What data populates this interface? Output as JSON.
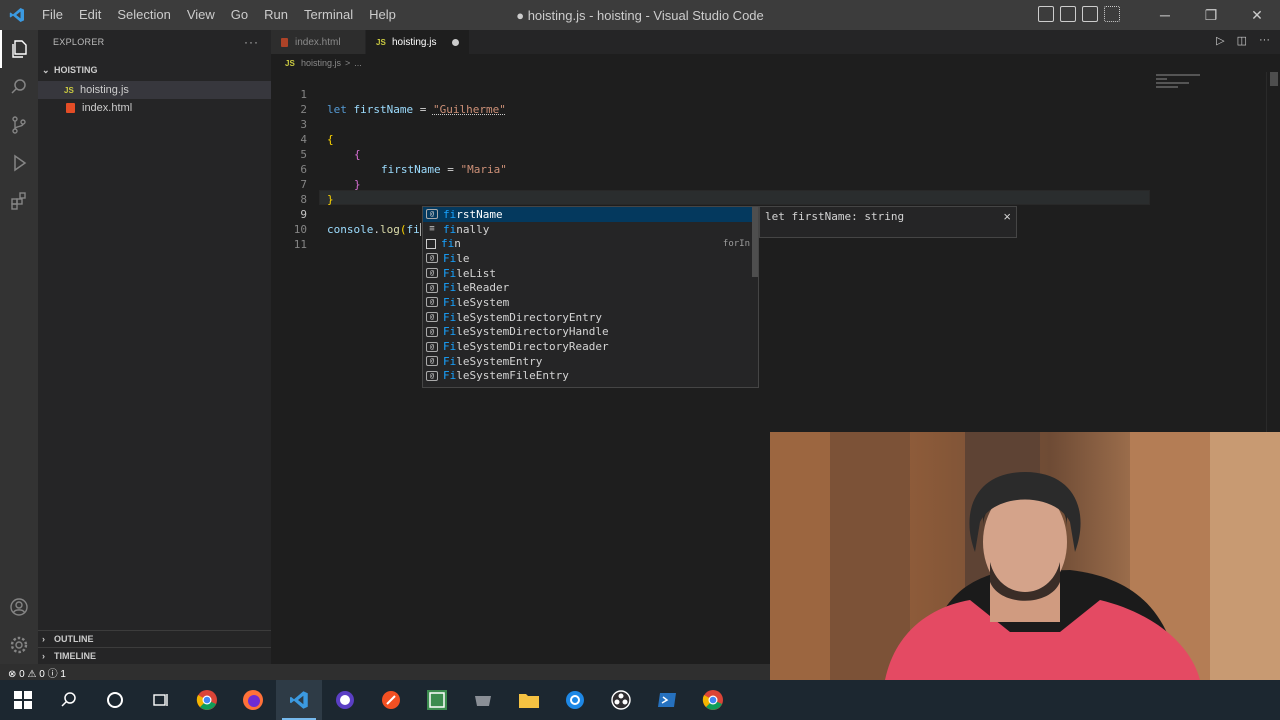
{
  "window": {
    "title": "● hoisting.js - hoisting - Visual Studio Code",
    "logo": "vscode-icon"
  },
  "menu": [
    "File",
    "Edit",
    "Selection",
    "View",
    "Go",
    "Run",
    "Terminal",
    "Help"
  ],
  "sidebar": {
    "header": "EXPLORER",
    "more": "···",
    "folder": "HOISTING",
    "files": [
      {
        "name": "hoisting.js",
        "type": "js",
        "icon_label": "JS",
        "active": true
      },
      {
        "name": "index.html",
        "type": "html",
        "active": false
      }
    ],
    "outline": "OUTLINE",
    "timeline": "TIMELINE"
  },
  "tabs": [
    {
      "label": "index.html",
      "active": false
    },
    {
      "label": "hoisting.js",
      "icon_label": "JS",
      "active": true,
      "dirty": true
    }
  ],
  "breadcrumb": {
    "icon_label": "JS",
    "file": "hoisting.js",
    "sep": ">",
    "rest": "..."
  },
  "editor": {
    "line_numbers": [
      "1",
      "2",
      "3",
      "4",
      "5",
      "6",
      "7",
      "8",
      "9",
      "10",
      "11"
    ],
    "current_line": 9,
    "lines": {
      "l1": {
        "kw": "let",
        "var": "firstName",
        "op": "=",
        "str": "\"Guilherme\""
      },
      "l3": {
        "brace": "{"
      },
      "l4": {
        "brace": "{"
      },
      "l5": {
        "var": "firstName",
        "op": "=",
        "str": "\"Maria\""
      },
      "l6": {
        "brace": "}"
      },
      "l7": {
        "brace": "}"
      },
      "l9": {
        "obj": "console",
        "dot": ".",
        "fn": "log",
        "paren": "(",
        "typed": "fi",
        "close": ")"
      }
    }
  },
  "suggest": {
    "items": [
      {
        "pre": "fi",
        "rest": "rstName",
        "kind": "variable",
        "icon": "[@]",
        "selected": true
      },
      {
        "pre": "fi",
        "rest": "nally",
        "kind": "keyword",
        "icon": "≡"
      },
      {
        "pre": "fi",
        "rest": "n",
        "kind": "snippet",
        "icon": "□",
        "detail": "forIn"
      },
      {
        "pre": "Fi",
        "rest": "le",
        "kind": "variable",
        "icon": "[@]"
      },
      {
        "pre": "Fi",
        "rest": "leList",
        "kind": "variable",
        "icon": "[@]"
      },
      {
        "pre": "Fi",
        "rest": "leReader",
        "kind": "variable",
        "icon": "[@]"
      },
      {
        "pre": "Fi",
        "rest": "leSystem",
        "kind": "variable",
        "icon": "[@]"
      },
      {
        "pre": "Fi",
        "rest": "leSystemDirectoryEntry",
        "kind": "variable",
        "icon": "[@]"
      },
      {
        "pre": "Fi",
        "rest": "leSystemDirectoryHandle",
        "kind": "variable",
        "icon": "[@]"
      },
      {
        "pre": "Fi",
        "rest": "leSystemDirectoryReader",
        "kind": "variable",
        "icon": "[@]"
      },
      {
        "pre": "Fi",
        "rest": "leSystemEntry",
        "kind": "variable",
        "icon": "[@]"
      },
      {
        "pre": "Fi",
        "rest": "leSystemFileEntry",
        "kind": "variable",
        "icon": "[@]"
      }
    ],
    "details": "let firstName: string",
    "close": "×"
  },
  "statusbar": {
    "remote_icon": "⊗",
    "errors": "0",
    "warn_icon": "⚠",
    "warnings": "0",
    "info_icon": "ⓘ",
    "info": "1"
  },
  "taskbar": {
    "icons": [
      "windows-start-icon",
      "search-icon",
      "cortana-icon",
      "task-view-icon",
      "chrome-icon",
      "firefox-icon",
      "vscode-icon",
      "purple-app-icon",
      "orange-app-icon",
      "green-app-icon",
      "game-icon",
      "file-explorer-icon",
      "blue-app-icon",
      "obs-icon",
      "powershell-icon",
      "chrome-icon"
    ]
  },
  "colors": {
    "accent": "#007acc",
    "keyword": "#569cd6",
    "variable": "#9cdcfe",
    "string": "#ce9178",
    "bracket1": "#ffd700",
    "bracket2": "#da70d6",
    "function": "#dcdcaa",
    "match": "#18a3ff"
  }
}
